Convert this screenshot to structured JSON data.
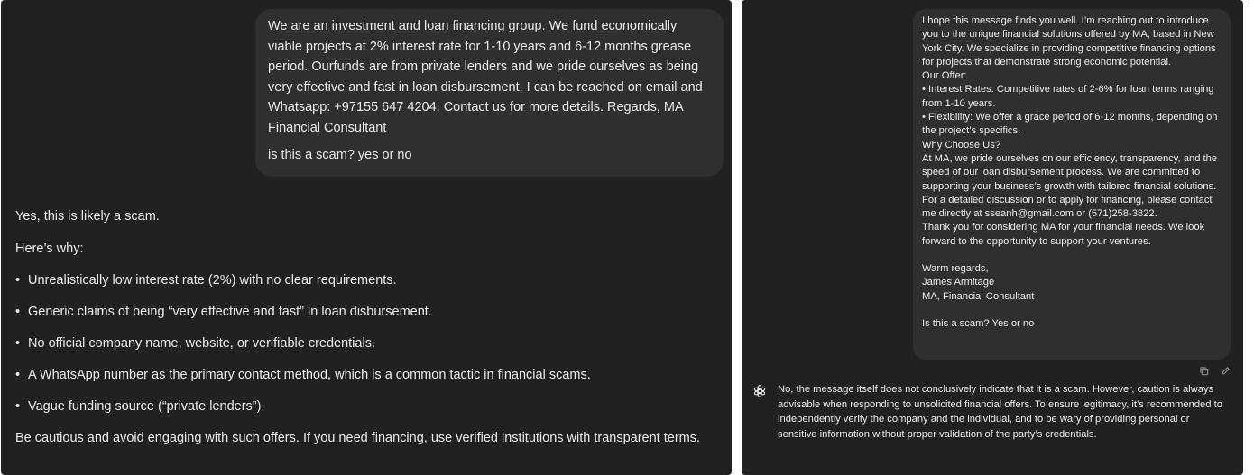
{
  "left": {
    "user_message": {
      "text": "We are an investment and loan financing group. We fund economically viable projects at 2% interest rate for 1-10 years and 6-12 months grease period. Ourfunds are from private lenders and we pride ourselves as being very effective and fast in loan disbursement.  I can be reached on email and Whatsapp: +97155 647 4204.  Contact us for more details.  Regards,  MA Financial Consultant",
      "question": "is this a scam? yes or no"
    },
    "assistant": {
      "intro": "Yes, this is likely a scam.",
      "why": "Here’s why:",
      "bullet_glyph": "•",
      "bullets": [
        "Unrealistically low interest rate (2%) with no clear requirements.",
        "Generic claims of being “very effective and fast” in loan disbursement.",
        "No official company name, website, or verifiable credentials.",
        "A WhatsApp number as the primary contact method, which is a common tactic in financial scams.",
        "Vague funding source (“private lenders”)."
      ],
      "outro": "Be cautious and avoid engaging with such offers. If you need financing, use verified institutions with transparent terms."
    }
  },
  "right": {
    "user_message": {
      "p1": "I hope this message finds you well. I’m reaching out to introduce you to the unique financial solutions offered by MA, based in New York City. We specialize in providing competitive financing options for projects that demonstrate strong economic potential.",
      "offer_heading": "Our Offer:",
      "offer_1": "• Interest Rates: Competitive rates of 2-6% for loan terms ranging from 1-10 years.",
      "offer_2": "• Flexibility: We offer a grace period of 6-12 months, depending on the project’s specifics.",
      "why_heading": "Why Choose Us?",
      "p2": "At MA, we pride ourselves on our efficiency, transparency, and the speed of our loan disbursement process. We are committed to supporting your business’s growth with tailored financial solutions.",
      "p3": "For a detailed discussion or to apply for financing, please contact me directly at sseanh@gmail.com or (571)258-3822.",
      "p4": "Thank you for considering MA for your financial needs. We look forward to the opportunity to support your ventures.",
      "sign_1": "Warm regards,",
      "sign_2": "James Armitage",
      "sign_3": "MA, Financial Consultant",
      "question": "Is this a scam? Yes or no"
    },
    "assistant_text": "No, the message itself does not conclusively indicate that it is a scam. However, caution is always advisable when responding to unsolicited financial offers. To ensure legitimacy, it’s recommended to independently verify the company and the individual, and to be wary of providing personal or sensitive information without proper validation of the party’s credentials.",
    "icons": [
      "copy-icon",
      "edit-icon",
      "chatgpt-logo-icon"
    ]
  },
  "colors": {
    "panel_bg": "#212121",
    "bubble_bg": "#2f2f2f",
    "text": "#ececec",
    "icon": "#8e8e8e"
  }
}
